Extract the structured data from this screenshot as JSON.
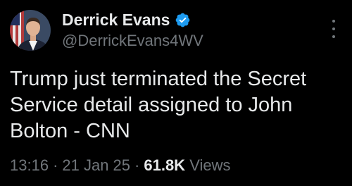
{
  "author": {
    "display_name": "Derrick Evans",
    "handle": "@DerrickEvans4WV",
    "verified_icon": "verified-badge-icon",
    "verified_color": "#1d9bf0"
  },
  "tweet": {
    "text": "Trump just terminated the Secret Service detail assigned to John Bolton - CNN"
  },
  "meta": {
    "time": "13:16",
    "separator": "·",
    "date": "21 Jan 25",
    "views_count": "61.8K",
    "views_label": "Views"
  },
  "icons": {
    "more": "more-options-icon"
  },
  "colors": {
    "background": "#000000",
    "primary_text": "#e7e9ea",
    "secondary_text": "#71767b"
  }
}
